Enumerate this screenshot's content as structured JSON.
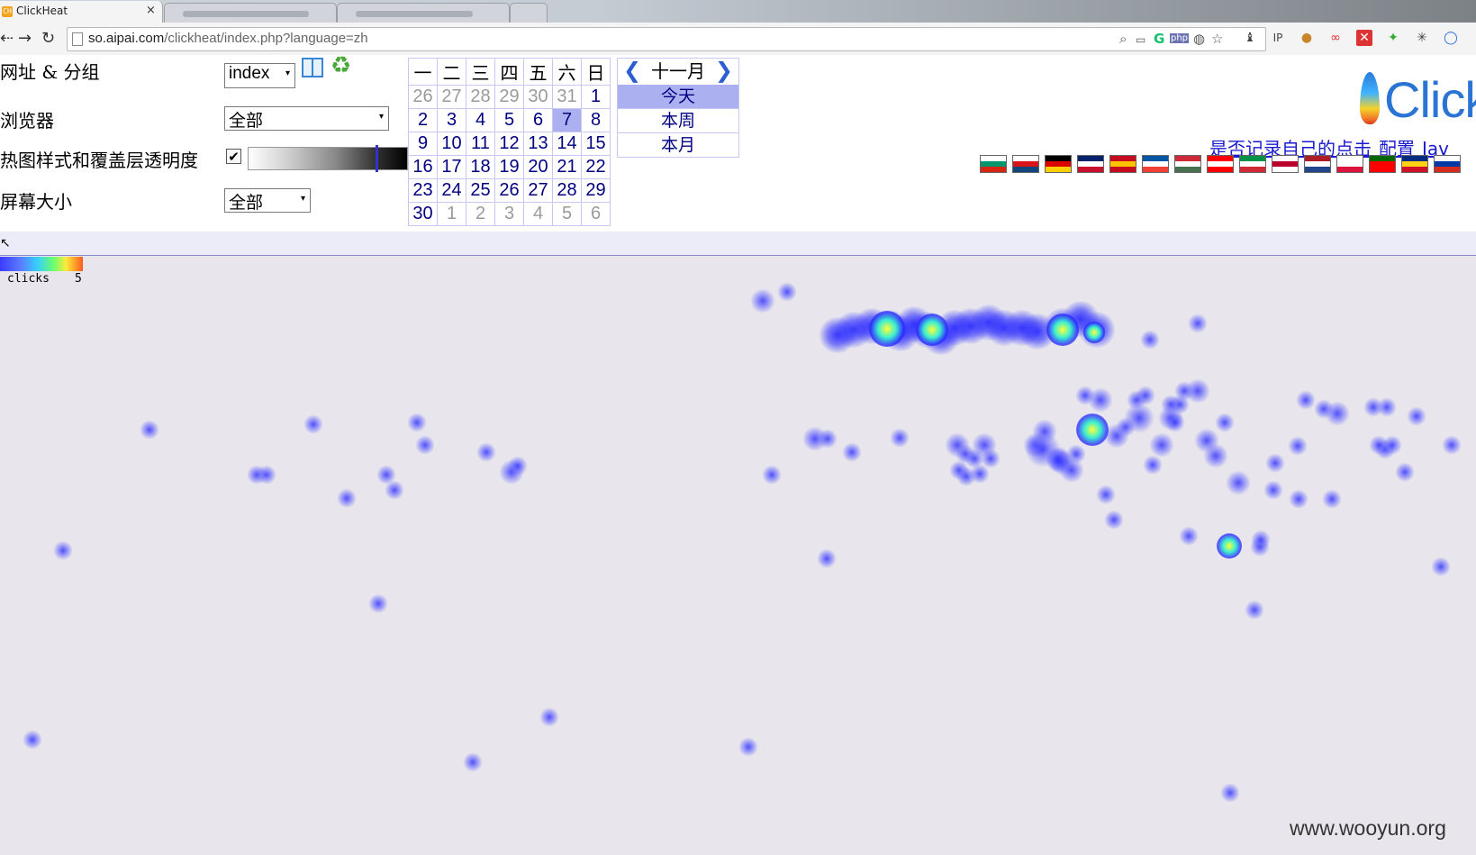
{
  "browser": {
    "tab_title": "ClickHeat",
    "tab_close": "×",
    "favicon_text": "CH",
    "url_host": "so.aipai.com",
    "url_path": "/clickheat/index.php?language=zh",
    "back_glyph": "⇠",
    "forward_glyph": "→",
    "reload_glyph": "↻",
    "icons": [
      "zoom-icon",
      "cast-icon",
      "grammarly-icon",
      "php-icon",
      "bulb-icon",
      "star-icon",
      "owl-icon",
      "ip-icon",
      "cookie-icon",
      "link-icon",
      "close-ext-icon",
      "bug-icon",
      "spider-icon",
      "circle-icon"
    ]
  },
  "form": {
    "url_group_label": "网址 & 分组",
    "url_group_value": "index",
    "browser_label": "浏览器",
    "browser_value": "全部",
    "style_label": "热图样式和覆盖层透明度",
    "screen_label": "屏幕大小",
    "screen_value": "全部",
    "checkbox_mark": "✔",
    "select_arrow": "▾"
  },
  "calendar": {
    "weekdays": [
      "一",
      "二",
      "三",
      "四",
      "五",
      "六",
      "日"
    ],
    "weeks": [
      [
        {
          "d": "26",
          "out": true
        },
        {
          "d": "27",
          "out": true
        },
        {
          "d": "28",
          "out": true
        },
        {
          "d": "29",
          "out": true
        },
        {
          "d": "30",
          "out": true
        },
        {
          "d": "31",
          "out": true
        },
        {
          "d": "1"
        }
      ],
      [
        {
          "d": "2"
        },
        {
          "d": "3"
        },
        {
          "d": "4"
        },
        {
          "d": "5"
        },
        {
          "d": "6"
        },
        {
          "d": "7",
          "sel": true
        },
        {
          "d": "8"
        }
      ],
      [
        {
          "d": "9"
        },
        {
          "d": "10"
        },
        {
          "d": "11"
        },
        {
          "d": "12"
        },
        {
          "d": "13"
        },
        {
          "d": "14"
        },
        {
          "d": "15"
        }
      ],
      [
        {
          "d": "16"
        },
        {
          "d": "17"
        },
        {
          "d": "18"
        },
        {
          "d": "19"
        },
        {
          "d": "20"
        },
        {
          "d": "21"
        },
        {
          "d": "22"
        }
      ],
      [
        {
          "d": "23"
        },
        {
          "d": "24"
        },
        {
          "d": "25"
        },
        {
          "d": "26"
        },
        {
          "d": "27"
        },
        {
          "d": "28"
        },
        {
          "d": "29"
        }
      ],
      [
        {
          "d": "30"
        },
        {
          "d": "1",
          "out": true
        },
        {
          "d": "2",
          "out": true
        },
        {
          "d": "3",
          "out": true
        },
        {
          "d": "4",
          "out": true
        },
        {
          "d": "5",
          "out": true
        },
        {
          "d": "6",
          "out": true
        }
      ]
    ],
    "month": "十一月",
    "prev_glyph": "❮",
    "next_glyph": "❯",
    "ranges": [
      "今天",
      "本周",
      "本月"
    ]
  },
  "header_right": {
    "logo_text": "Click",
    "link_record": "是否记录自己的点击",
    "link_config": "配置",
    "link_js": "Jav",
    "flags": [
      [
        "#ffffff",
        "#00966e",
        "#d62612"
      ],
      [
        "#ffffff",
        "#d7141a",
        "#11457e"
      ],
      [
        "#000000",
        "#dd0000",
        "#ffce00"
      ],
      [
        "#012169",
        "#ffffff",
        "#c8102e"
      ],
      [
        "#c60b1e",
        "#ffc400",
        "#c60b1e"
      ],
      [
        "#0055a4",
        "#ffffff",
        "#ef4135"
      ],
      [
        "#ce2939",
        "#ffffff",
        "#477050"
      ],
      [
        "#ff0000",
        "#ffffff",
        "#ff0000"
      ],
      [
        "#009246",
        "#ffffff",
        "#ce2b37"
      ],
      [
        "#ffffff",
        "#bc002d",
        "#ffffff"
      ],
      [
        "#ae1c28",
        "#ffffff",
        "#21468b"
      ],
      [
        "#ffffff",
        "#ffffff",
        "#dc143c"
      ],
      [
        "#006600",
        "#ff0000",
        "#ff0000"
      ],
      [
        "#002b7f",
        "#fcd116",
        "#ce1126"
      ],
      [
        "#ffffff",
        "#0039a6",
        "#d52b1e"
      ]
    ]
  },
  "heatmap": {
    "legend_label": "clicks",
    "legend_max": "5",
    "colors": {
      "low": "#5a5aff",
      "mid": "#2a2aff",
      "hot": "#3cf0d0",
      "peak": "#ffff3a"
    }
  },
  "watermark": "www.wooyun.org"
}
